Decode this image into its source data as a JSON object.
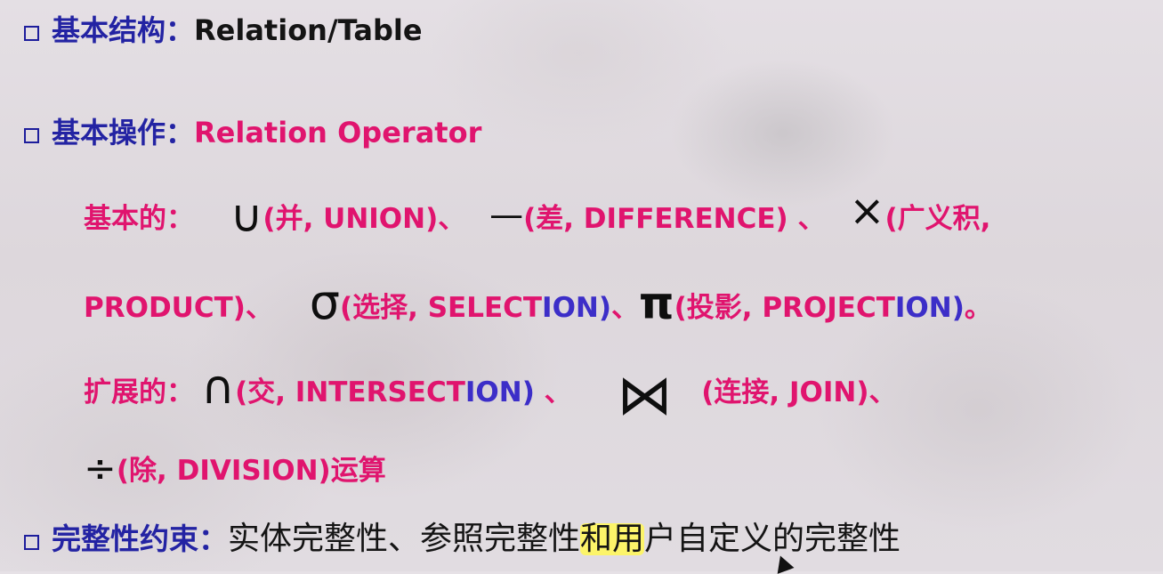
{
  "bullets": {
    "structure": {
      "label": "基本结构：",
      "value": "Relation/Table"
    },
    "operation": {
      "label": "基本操作：",
      "value": "Relation Operator"
    },
    "integrity": {
      "label": "完整性约束：",
      "value_a": "实体完整性、参照完整性",
      "value_b": "和用",
      "value_c": "户自定义的完整性"
    }
  },
  "basic": {
    "heading": "基本的：",
    "union": {
      "symbol": "∪",
      "text": "(并, UNION)、"
    },
    "difference": {
      "symbol": "—",
      "text": "(差, DIFFERENCE) 、"
    },
    "product": {
      "symbol": "×",
      "text_a": "(广义积,",
      "text_b": "PRODUCT)、"
    },
    "selection": {
      "symbol": "σ",
      "text_a": "(选择, SELECT",
      "text_b": "ION)",
      "text_c": "、"
    },
    "projection": {
      "symbol": "π",
      "text_a": "(投影, PROJECT",
      "text_b": "ION)",
      "text_c": "。"
    }
  },
  "extended": {
    "heading": "扩展的：",
    "intersection": {
      "symbol": "∩",
      "text_a": "(交, INTERSECT",
      "text_b": "ION)",
      "text_c": " 、"
    },
    "join": {
      "symbol": "⋈",
      "text": "(连接, JOIN)、"
    },
    "division": {
      "symbol": "÷",
      "text": "(除, DIVISION)运算"
    }
  },
  "colors": {
    "heading": "#2323a3",
    "highlight": "#e0146e",
    "accent": "#3c2ec8",
    "body": "#141414",
    "marker": "#fff65c"
  }
}
